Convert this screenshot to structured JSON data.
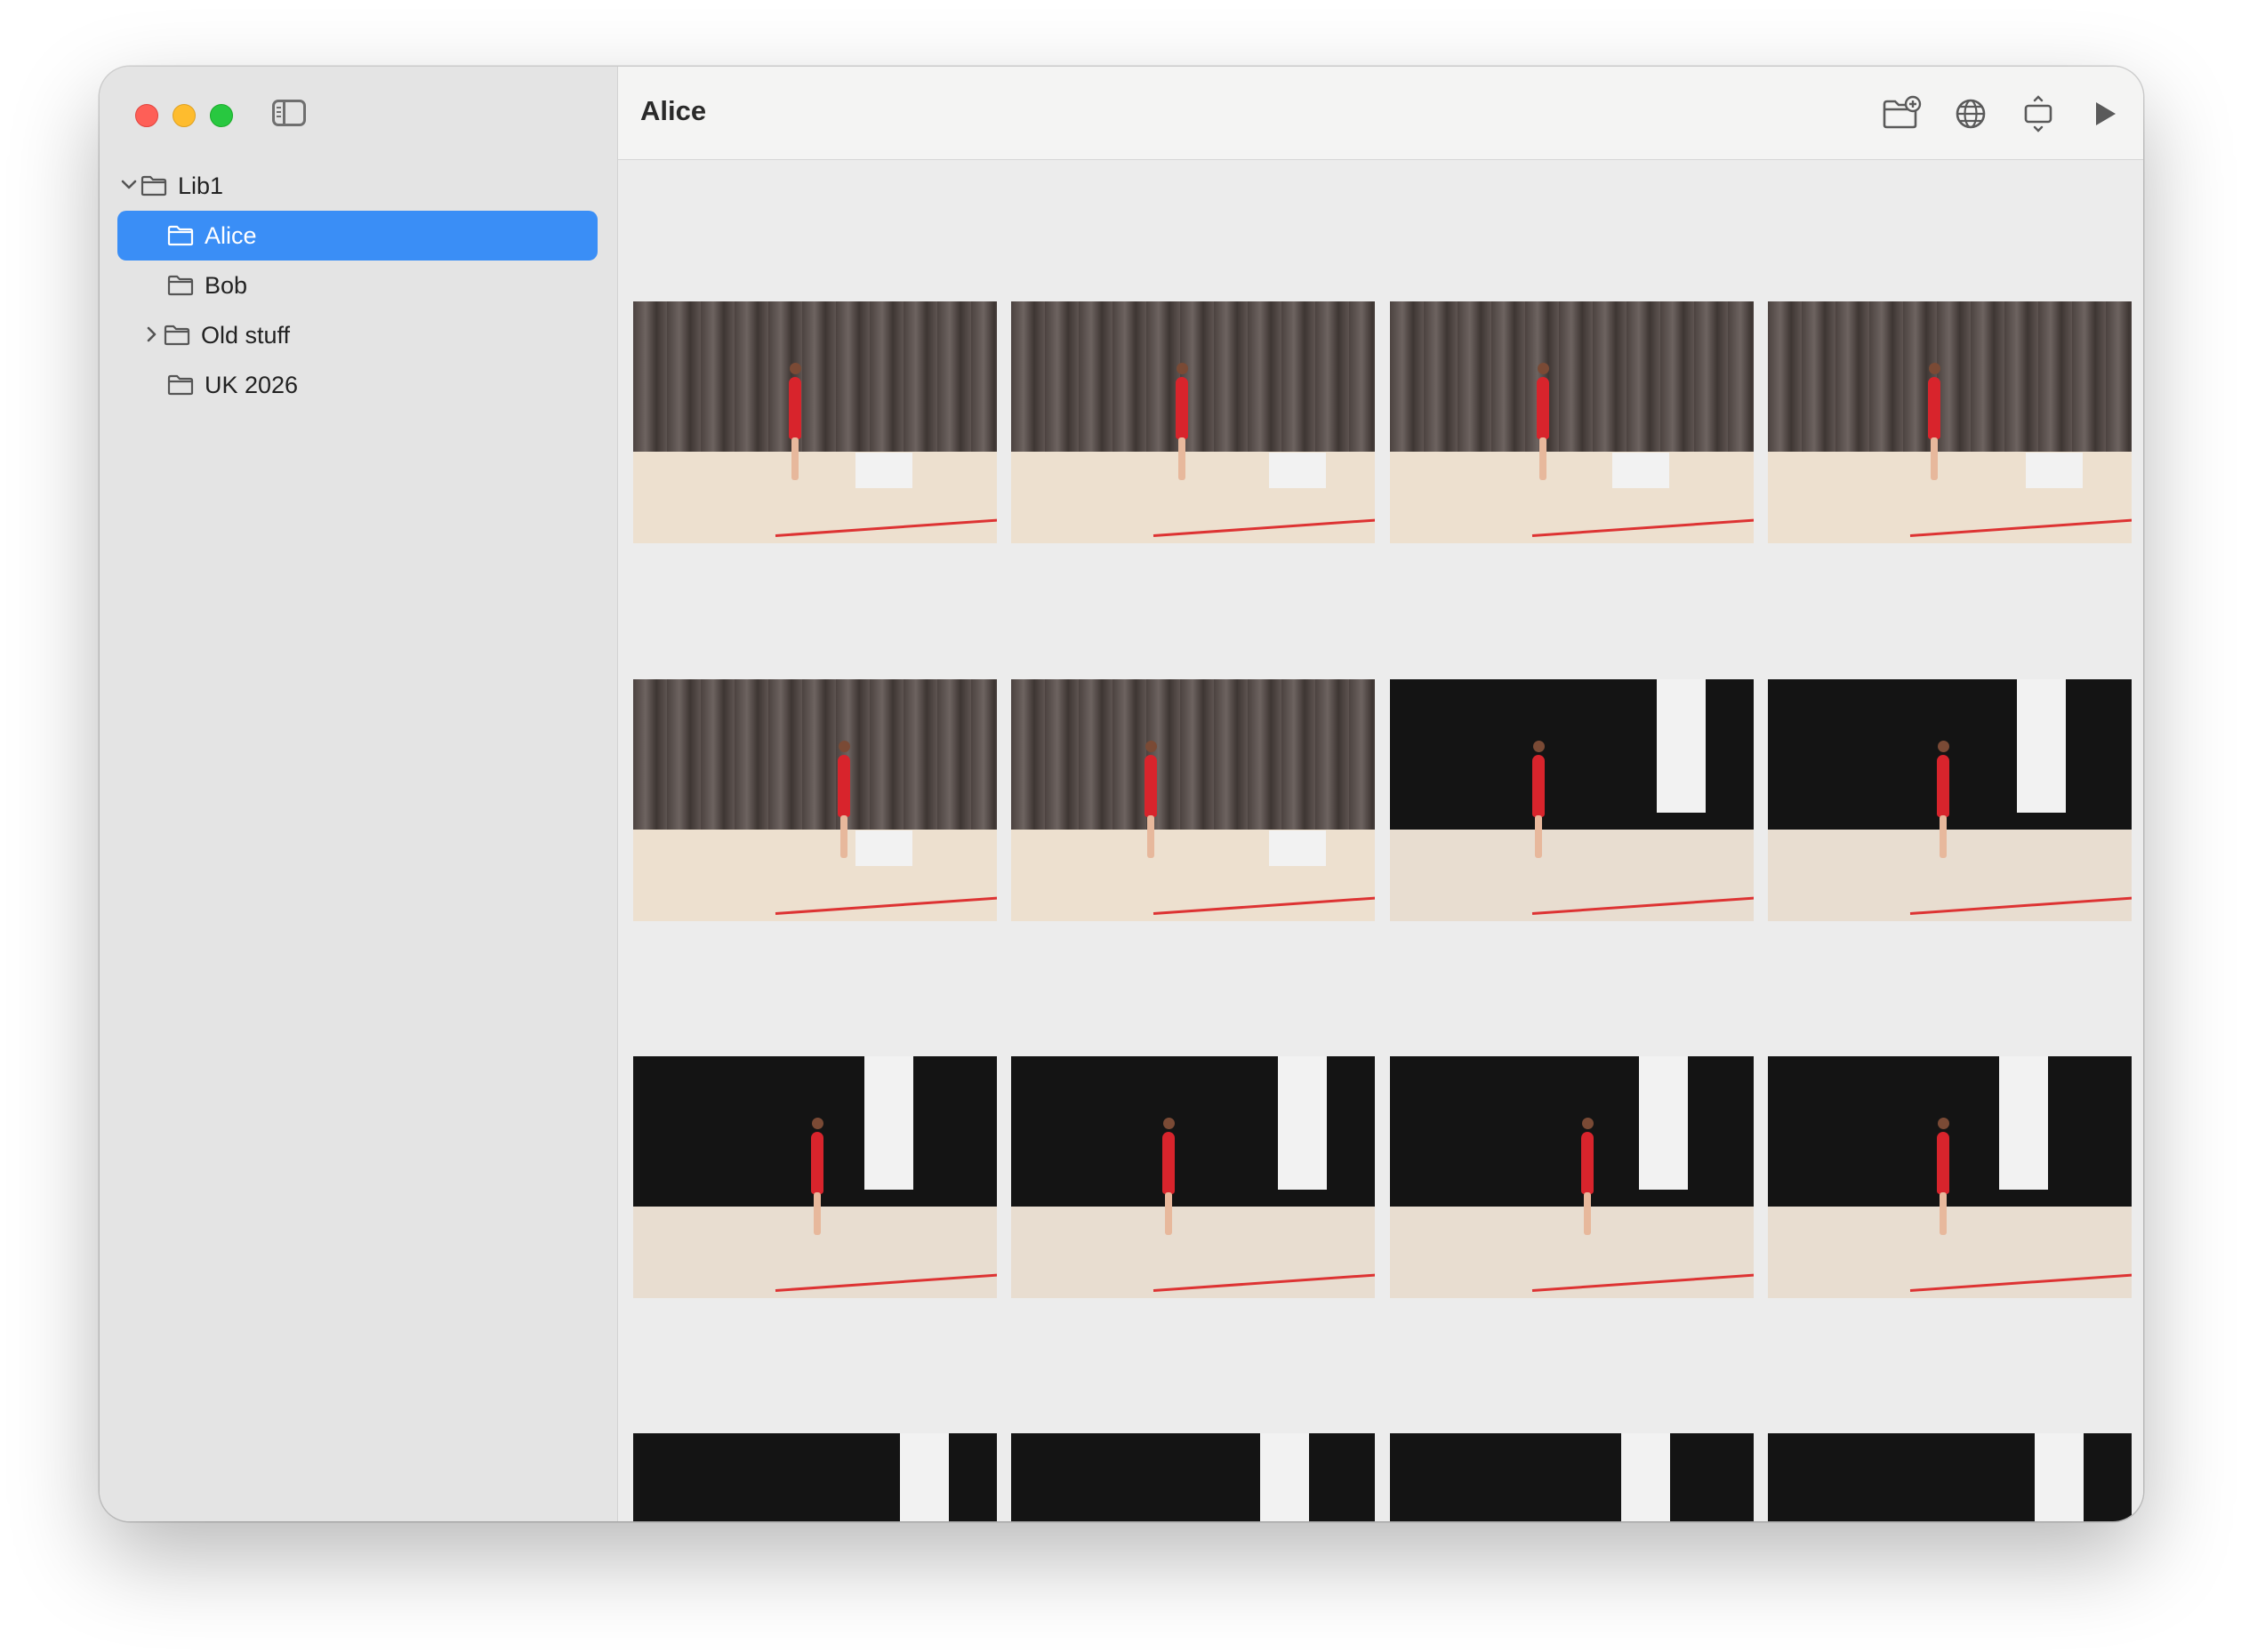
{
  "window": {
    "title": "Alice"
  },
  "sidebar": {
    "items": [
      {
        "label": "Lib1",
        "level": 0,
        "expanded": true,
        "selected": false
      },
      {
        "label": "Alice",
        "level": 1,
        "expanded": false,
        "selected": true
      },
      {
        "label": "Bob",
        "level": 1,
        "expanded": false,
        "selected": false
      },
      {
        "label": "Old stuff",
        "level": 1,
        "expanded": false,
        "selected": false,
        "has_children": true
      },
      {
        "label": "UK 2026",
        "level": 1,
        "expanded": false,
        "selected": false
      }
    ]
  },
  "toolbar": {
    "buttons": [
      {
        "icon": "new-folder-icon"
      },
      {
        "icon": "globe-icon"
      },
      {
        "icon": "fit-screen-icon"
      },
      {
        "icon": "play-icon"
      }
    ]
  },
  "photos": [
    {
      "scene": "curtain"
    },
    {
      "scene": "curtain"
    },
    {
      "scene": "curtain"
    },
    {
      "scene": "curtain"
    },
    {
      "scene": "curtain"
    },
    {
      "scene": "curtain"
    },
    {
      "scene": "black"
    },
    {
      "scene": "black"
    },
    {
      "scene": "black"
    },
    {
      "scene": "black"
    },
    {
      "scene": "black"
    },
    {
      "scene": "black"
    },
    {
      "scene": "black"
    },
    {
      "scene": "black"
    },
    {
      "scene": "black"
    },
    {
      "scene": "black"
    }
  ],
  "colors": {
    "selection": "#3a8ef6",
    "costume": "#d8242c"
  }
}
